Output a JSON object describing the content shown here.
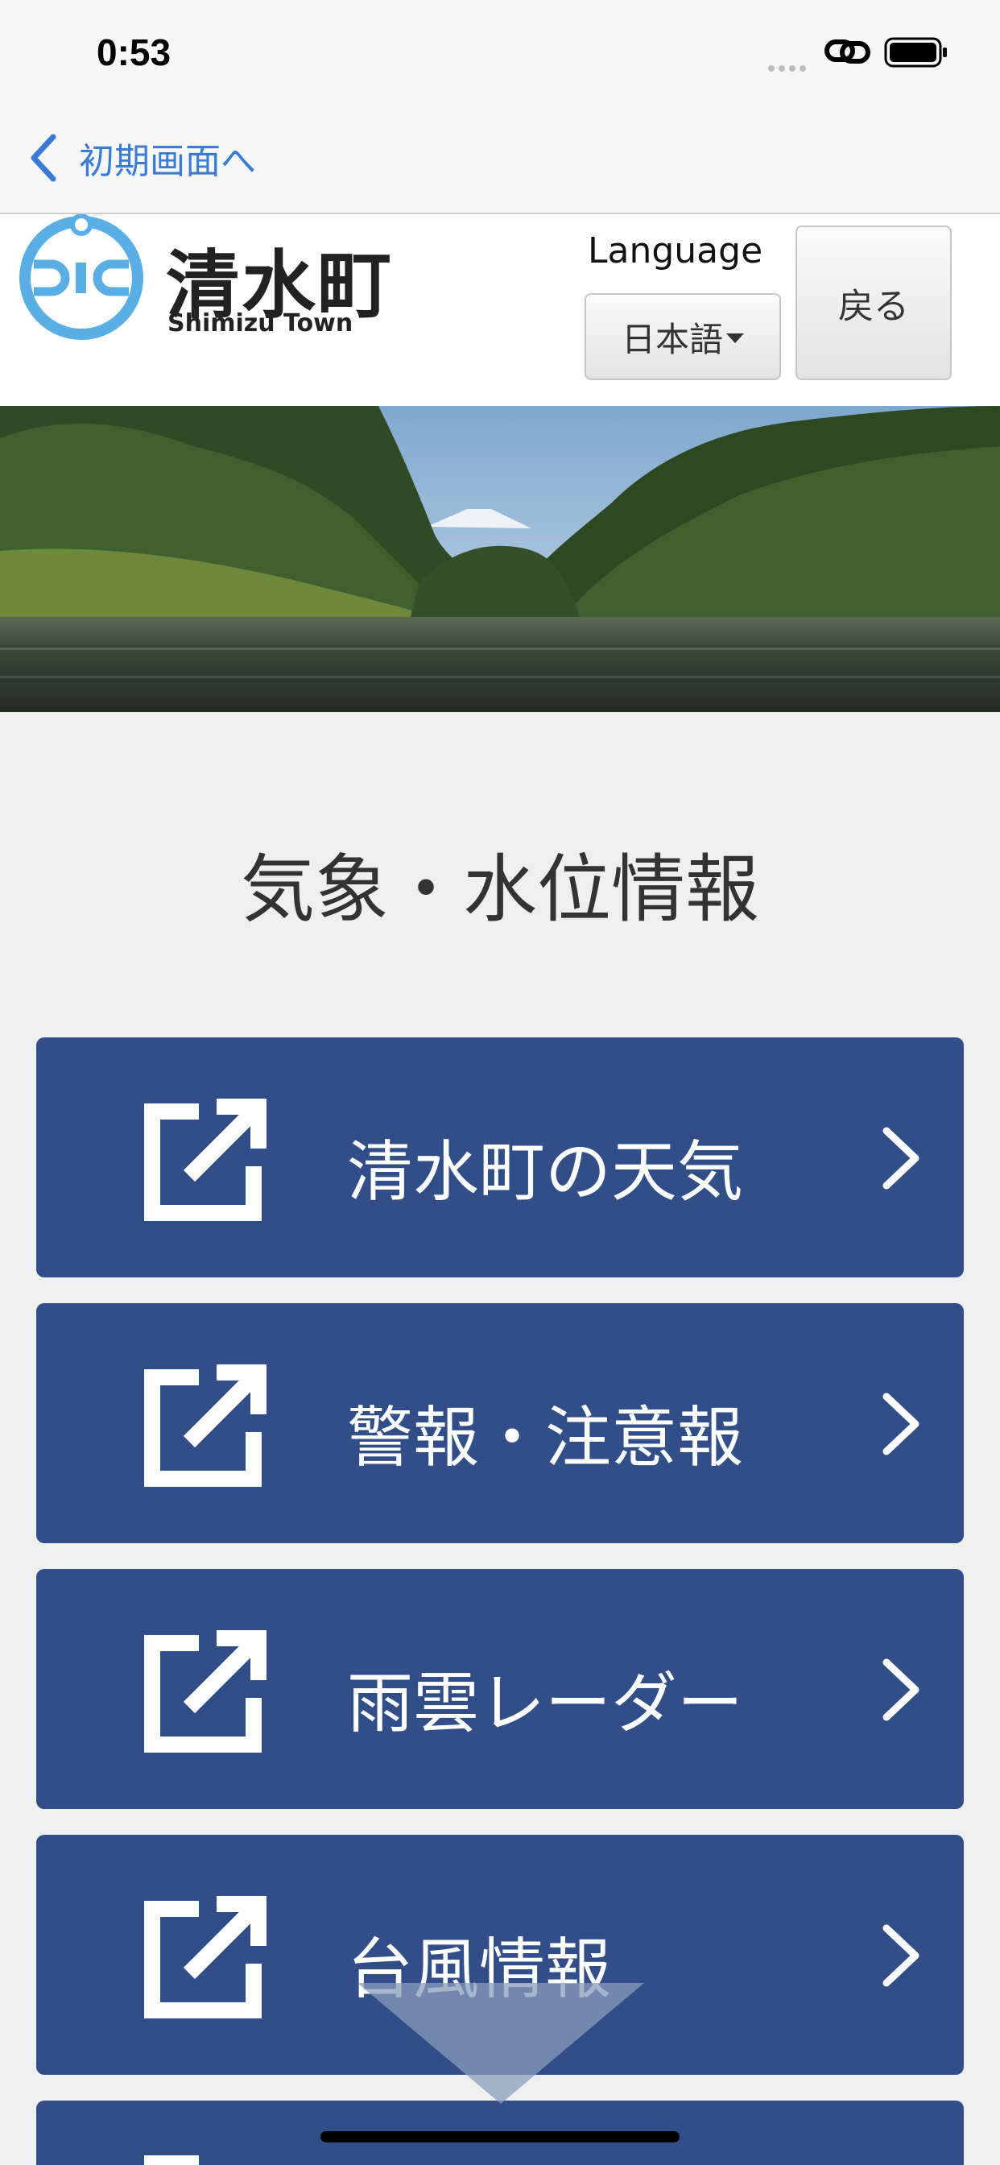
{
  "status_bar": {
    "time": "0:53",
    "icons": [
      "signal-dots-icon",
      "link-icon",
      "battery-icon"
    ]
  },
  "nav": {
    "back_label": "初期画面へ",
    "back_icon": "chevron-left-icon",
    "accent_color": "#3a7bd5"
  },
  "header": {
    "logo_title": "清水町",
    "logo_subtitle": "Shimizu Town",
    "logo_letters": "SIC",
    "language_label": "Language",
    "language_value": "日本語",
    "back_button_label": "戻る"
  },
  "page": {
    "title": "気象・水位情報"
  },
  "menu": {
    "items": [
      {
        "label": "清水町の天気",
        "icon": "external-link-icon"
      },
      {
        "label": "警報・注意報",
        "icon": "external-link-icon"
      },
      {
        "label": "雨雲レーダー",
        "icon": "external-link-icon"
      },
      {
        "label": "台風情報",
        "icon": "external-link-icon"
      }
    ],
    "button_color": "#314e89"
  }
}
